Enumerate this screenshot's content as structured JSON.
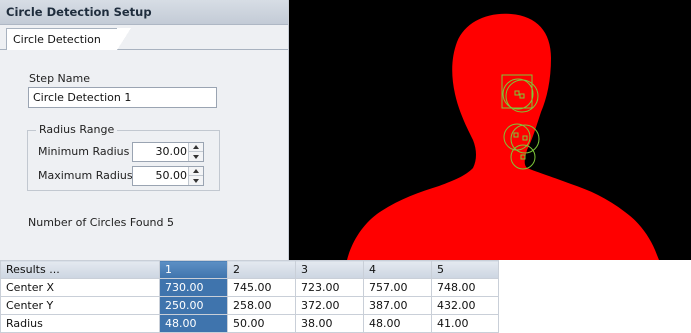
{
  "panel": {
    "title": "Circle Detection Setup",
    "tab_label": "Circle Detection",
    "step_name_label": "Step Name",
    "step_name_value": "Circle Detection 1",
    "radius_range": {
      "title": "Radius Range",
      "min_label": "Minimum Radius",
      "min_value": "30.00",
      "max_label": "Maximum Radius",
      "max_value": "50.00"
    },
    "circles_found_label": "Number of Circles Found :",
    "circles_found_value": "5"
  },
  "image": {
    "background_color": "#000000",
    "silhouette_color": "#ff0000",
    "overlay_color": "#7ec83a"
  },
  "results": {
    "header": [
      "Results ...",
      "1",
      "2",
      "3",
      "4",
      "5"
    ],
    "selected_column": 1,
    "rows": [
      {
        "label": "Center X",
        "values": [
          "730.00",
          "745.00",
          "723.00",
          "757.00",
          "748.00"
        ]
      },
      {
        "label": "Center Y",
        "values": [
          "250.00",
          "258.00",
          "372.00",
          "387.00",
          "432.00"
        ]
      },
      {
        "label": "Radius",
        "values": [
          "48.00",
          "50.00",
          "38.00",
          "48.00",
          "41.00"
        ]
      }
    ]
  }
}
